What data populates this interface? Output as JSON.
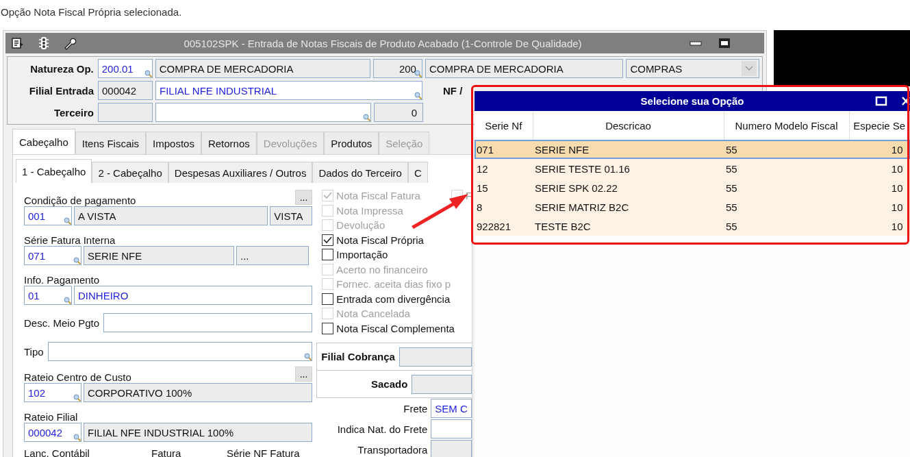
{
  "caption": "Opção Nota Fiscal Própria selecionada.",
  "window": {
    "title": "005102SPK - Entrada de Notas Fiscais de Produto Acabado (1-Controle De Qualidade)"
  },
  "header": {
    "rows": [
      {
        "label": "Natureza Op.",
        "fields": [
          {
            "kind": "text",
            "value": "200.01",
            "editable": true,
            "linked": true,
            "lookup": true
          },
          {
            "kind": "text",
            "value": "COMPRA DE MERCADORIA",
            "editable": false,
            "linked": false,
            "lookup": false
          },
          {
            "kind": "number",
            "value": "200",
            "editable": false,
            "linked": false,
            "lookup": true
          },
          {
            "kind": "text",
            "value": "COMPRA DE MERCADORIA",
            "editable": false,
            "linked": false,
            "lookup": false
          },
          {
            "kind": "dropdown",
            "value": "COMPRAS",
            "editable": false,
            "linked": false,
            "lookup": false
          }
        ]
      },
      {
        "label": "Filial Entrada",
        "fields": [
          {
            "kind": "text",
            "value": "000042",
            "editable": false,
            "linked": false,
            "lookup": false
          },
          {
            "kind": "text",
            "value": "FILIAL NFE INDUSTRIAL",
            "editable": true,
            "linked": true,
            "lookup": true
          }
        ],
        "trailing_label": "NF /"
      },
      {
        "label": "Terceiro",
        "fields": [
          {
            "kind": "text",
            "editable": false,
            "lookup": false
          },
          {
            "kind": "text",
            "editable": true,
            "lookup": true
          },
          {
            "kind": "number",
            "value": "0",
            "editable": false,
            "linked": false,
            "lookup": false
          }
        ]
      }
    ]
  },
  "tabs": [
    {
      "label": "Cabeçalho",
      "selected": true,
      "disabled": false
    },
    {
      "label": "Itens Fiscais",
      "selected": false,
      "disabled": false
    },
    {
      "label": "Impostos",
      "selected": false,
      "disabled": false
    },
    {
      "label": "Retornos",
      "selected": false,
      "disabled": false
    },
    {
      "label": "Devoluções",
      "selected": false,
      "disabled": true
    },
    {
      "label": "Produtos",
      "selected": false,
      "disabled": false
    },
    {
      "label": "Seleção",
      "selected": false,
      "disabled": true
    }
  ],
  "subtabs": [
    {
      "label": "1 - Cabeçalho",
      "selected": true
    },
    {
      "label": "2 - Cabeçalho",
      "selected": false
    },
    {
      "label": "Despesas Auxiliares / Outros",
      "selected": false
    },
    {
      "label": "Dados do Terceiro",
      "selected": false
    },
    {
      "label": "C",
      "selected": false
    }
  ],
  "sections": [
    {
      "kind": "stacked",
      "label": "Condição de pagamento",
      "button": "...",
      "fields": [
        {
          "kind": "text",
          "value": "001",
          "editable": true,
          "linked": true,
          "lookup": true
        },
        {
          "kind": "text",
          "value": "A VISTA",
          "editable": false,
          "linked": false,
          "lookup": false
        },
        {
          "kind": "text",
          "value": "VISTA",
          "editable": false,
          "linked": false,
          "lookup": false
        }
      ]
    },
    {
      "kind": "stacked",
      "label": "Série Fatura Interna",
      "fields": [
        {
          "kind": "text",
          "value": "071",
          "editable": true,
          "linked": true,
          "lookup": true
        },
        {
          "kind": "text",
          "value": "SERIE NFE",
          "editable": false,
          "linked": false,
          "lookup": false
        },
        {
          "kind": "text",
          "value": "...",
          "editable": false,
          "linked": false,
          "lookup": false
        }
      ]
    },
    {
      "kind": "stacked",
      "label": "Info. Pagamento",
      "fields": [
        {
          "kind": "text",
          "value": "01",
          "editable": true,
          "linked": true,
          "lookup": true
        },
        {
          "kind": "text",
          "value": "DINHEIRO",
          "editable": true,
          "linked": true,
          "lookup": false
        }
      ]
    },
    {
      "kind": "inline",
      "label": "Desc. Meio Pgto",
      "fields": [
        {
          "kind": "text",
          "editable": true,
          "lookup": false
        }
      ]
    },
    {
      "kind": "inline",
      "label": "Tipo",
      "fields": [
        {
          "kind": "text",
          "editable": true,
          "lookup": true
        }
      ]
    },
    {
      "kind": "stacked",
      "label": "Rateio Centro de Custo",
      "button": "...",
      "fields": [
        {
          "kind": "text",
          "value": "102",
          "editable": true,
          "linked": true,
          "lookup": true
        },
        {
          "kind": "text",
          "value": "CORPORATIVO 100%",
          "editable": false,
          "linked": false,
          "lookup": false
        }
      ]
    },
    {
      "kind": "stacked",
      "label": "Rateio Filial",
      "fields": [
        {
          "kind": "text",
          "value": "000042",
          "editable": true,
          "linked": true,
          "lookup": true
        },
        {
          "kind": "text",
          "value": "FILIAL NFE INDUSTRIAL 100%",
          "editable": false,
          "linked": false,
          "lookup": false
        }
      ]
    }
  ],
  "footer_labels": [
    "Lanc. Contábil",
    "Fatura",
    "Série NF Fatura"
  ],
  "checks": [
    {
      "label": "Nota Fiscal Fatura",
      "checked": true,
      "disabled": true
    },
    {
      "label": "Nota Impressa",
      "checked": false,
      "disabled": true
    },
    {
      "label": "Devolução",
      "checked": false,
      "disabled": true
    },
    {
      "label": "Nota Fiscal Própria",
      "checked": true,
      "disabled": false
    },
    {
      "label": "Importação",
      "checked": false,
      "disabled": false
    },
    {
      "label": "Acerto no financeiro",
      "checked": false,
      "disabled": true
    },
    {
      "label": "Fornec. aceita dias fixo p",
      "checked": false,
      "disabled": true
    },
    {
      "label": "Entrada com divergência",
      "checked": false,
      "disabled": false
    },
    {
      "label": "Nota Cancelada",
      "checked": false,
      "disabled": true
    },
    {
      "label": "Nota Fiscal Complementa",
      "checked": false,
      "disabled": false
    }
  ],
  "side_check": {
    "label": "F",
    "checked": false,
    "disabled": true
  },
  "billing": [
    {
      "label": "Filial Cobrança"
    },
    {
      "label": "Sacado"
    }
  ],
  "freight": [
    {
      "label": "Frete",
      "field": {
        "kind": "text",
        "value": "SEM C",
        "editable": true,
        "linked": true,
        "lookup": false
      }
    },
    {
      "label": "Indica Nat. do Frete",
      "field": {
        "kind": "text",
        "editable": true,
        "lookup": false
      }
    },
    {
      "label": "Transportadora",
      "field": {
        "kind": "text",
        "editable": false,
        "lookup": false
      }
    }
  ],
  "popup": {
    "title": "Selecione sua Opção",
    "columns": [
      "Serie Nf",
      "Descricao",
      "Numero Modelo Fiscal",
      "Especie Se"
    ],
    "rows": [
      {
        "cells": [
          "071",
          "SERIE NFE",
          "55",
          "10"
        ],
        "selected": true
      },
      {
        "cells": [
          "12",
          "SERIE TESTE 01.16",
          "55",
          "10"
        ],
        "selected": false
      },
      {
        "cells": [
          "15",
          "SERIE SPK 02.22",
          "55",
          "10"
        ],
        "selected": false
      },
      {
        "cells": [
          "8",
          "SERIE MATRIZ B2C",
          "55",
          "10"
        ],
        "selected": false
      },
      {
        "cells": [
          "922821",
          "TESTE B2C",
          "55",
          "10"
        ],
        "selected": false
      }
    ]
  }
}
